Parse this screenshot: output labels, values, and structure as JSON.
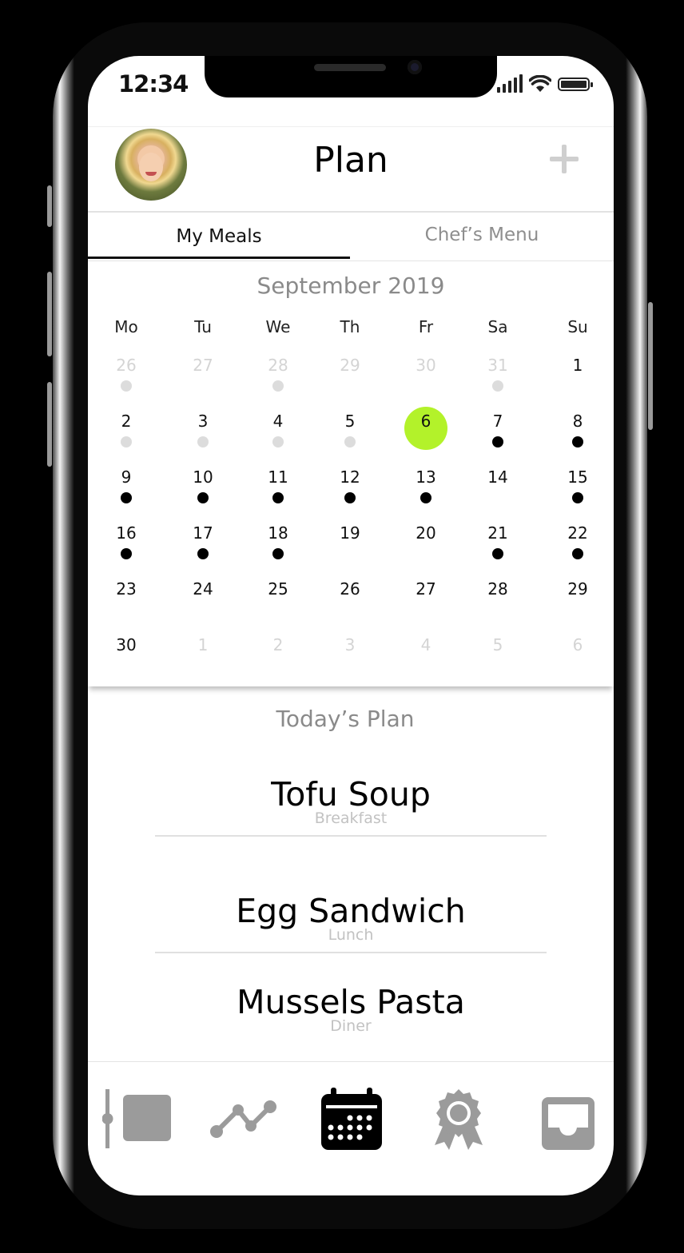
{
  "status_bar": {
    "time": "12:34"
  },
  "header": {
    "title": "Plan",
    "add_icon": "plus-icon",
    "avatar": "user-avatar"
  },
  "tabs": [
    {
      "label": "My Meals",
      "active": true
    },
    {
      "label": "Chef’s Menu",
      "active": false
    }
  ],
  "calendar": {
    "month_label": "September 2019",
    "weekdays": [
      "Mo",
      "Tu",
      "We",
      "Th",
      "Fr",
      "Sa",
      "Su"
    ],
    "selected_day": "6",
    "selected_color": "#b3f22a",
    "weeks": [
      [
        {
          "d": "26",
          "muted": true,
          "dot": "grey"
        },
        {
          "d": "27",
          "muted": true,
          "dot": ""
        },
        {
          "d": "28",
          "muted": true,
          "dot": "grey"
        },
        {
          "d": "29",
          "muted": true,
          "dot": ""
        },
        {
          "d": "30",
          "muted": true,
          "dot": ""
        },
        {
          "d": "31",
          "muted": true,
          "dot": "grey"
        },
        {
          "d": "1",
          "muted": false,
          "dot": ""
        }
      ],
      [
        {
          "d": "2",
          "muted": false,
          "dot": "grey"
        },
        {
          "d": "3",
          "muted": false,
          "dot": "grey"
        },
        {
          "d": "4",
          "muted": false,
          "dot": "grey"
        },
        {
          "d": "5",
          "muted": false,
          "dot": "grey"
        },
        {
          "d": "6",
          "muted": false,
          "dot": "",
          "selected": true
        },
        {
          "d": "7",
          "muted": false,
          "dot": "black"
        },
        {
          "d": "8",
          "muted": false,
          "dot": "black"
        }
      ],
      [
        {
          "d": "9",
          "muted": false,
          "dot": "black"
        },
        {
          "d": "10",
          "muted": false,
          "dot": "black"
        },
        {
          "d": "11",
          "muted": false,
          "dot": "black"
        },
        {
          "d": "12",
          "muted": false,
          "dot": "black"
        },
        {
          "d": "13",
          "muted": false,
          "dot": "black"
        },
        {
          "d": "14",
          "muted": false,
          "dot": ""
        },
        {
          "d": "15",
          "muted": false,
          "dot": "black"
        }
      ],
      [
        {
          "d": "16",
          "muted": false,
          "dot": "black"
        },
        {
          "d": "17",
          "muted": false,
          "dot": "black"
        },
        {
          "d": "18",
          "muted": false,
          "dot": "black"
        },
        {
          "d": "19",
          "muted": false,
          "dot": ""
        },
        {
          "d": "20",
          "muted": false,
          "dot": ""
        },
        {
          "d": "21",
          "muted": false,
          "dot": "black"
        },
        {
          "d": "22",
          "muted": false,
          "dot": "black"
        }
      ],
      [
        {
          "d": "23",
          "muted": false,
          "dot": ""
        },
        {
          "d": "24",
          "muted": false,
          "dot": ""
        },
        {
          "d": "25",
          "muted": false,
          "dot": ""
        },
        {
          "d": "26",
          "muted": false,
          "dot": ""
        },
        {
          "d": "27",
          "muted": false,
          "dot": ""
        },
        {
          "d": "28",
          "muted": false,
          "dot": ""
        },
        {
          "d": "29",
          "muted": false,
          "dot": ""
        }
      ],
      [
        {
          "d": "30",
          "muted": false,
          "dot": ""
        },
        {
          "d": "1",
          "muted": true,
          "dot": ""
        },
        {
          "d": "2",
          "muted": true,
          "dot": ""
        },
        {
          "d": "3",
          "muted": true,
          "dot": ""
        },
        {
          "d": "4",
          "muted": true,
          "dot": ""
        },
        {
          "d": "5",
          "muted": true,
          "dot": ""
        },
        {
          "d": "6",
          "muted": true,
          "dot": ""
        }
      ]
    ]
  },
  "todays_plan": {
    "title": "Today’s Plan",
    "meals": [
      {
        "name": "Tofu Soup",
        "type": "Breakfast"
      },
      {
        "name": "Egg Sandwich",
        "type": "Lunch"
      },
      {
        "name": "Mussels Pasta",
        "type": "Diner"
      }
    ]
  },
  "tab_bar": {
    "items": [
      {
        "icon": "dashboard-icon",
        "active": false
      },
      {
        "icon": "progress-chart-icon",
        "active": false
      },
      {
        "icon": "calendar-icon",
        "active": true
      },
      {
        "icon": "award-ribbon-icon",
        "active": false
      },
      {
        "icon": "inbox-icon",
        "active": false
      }
    ],
    "active_color": "#000000",
    "inactive_color": "#9b9b9b"
  }
}
